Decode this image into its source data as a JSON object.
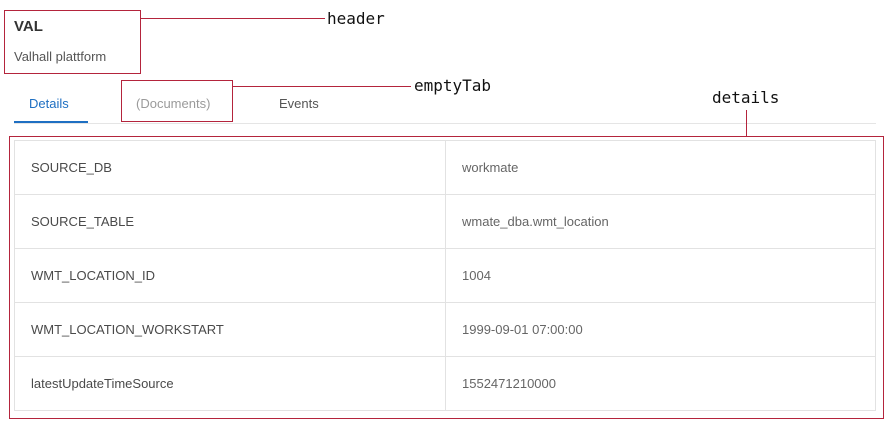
{
  "header": {
    "title": "VAL",
    "subtitle": "Valhall plattform"
  },
  "annotations": {
    "header": "header",
    "empty_tab": "emptyTab",
    "details": "details"
  },
  "tabs": [
    {
      "label": "Details",
      "active": true
    },
    {
      "label": "(Documents)",
      "active": false,
      "empty": true
    },
    {
      "label": "Events",
      "active": false
    }
  ],
  "details": {
    "rows": [
      {
        "key": "SOURCE_DB",
        "value": "workmate"
      },
      {
        "key": "SOURCE_TABLE",
        "value": "wmate_dba.wmt_location"
      },
      {
        "key": "WMT_LOCATION_ID",
        "value": "1004"
      },
      {
        "key": "WMT_LOCATION_WORKSTART",
        "value": "1999-09-01 07:00:00"
      },
      {
        "key": "latestUpdateTimeSource",
        "value": "1552471210000"
      }
    ]
  },
  "colors": {
    "accent": "#1e6fc2",
    "annotation": "#b4243c"
  }
}
